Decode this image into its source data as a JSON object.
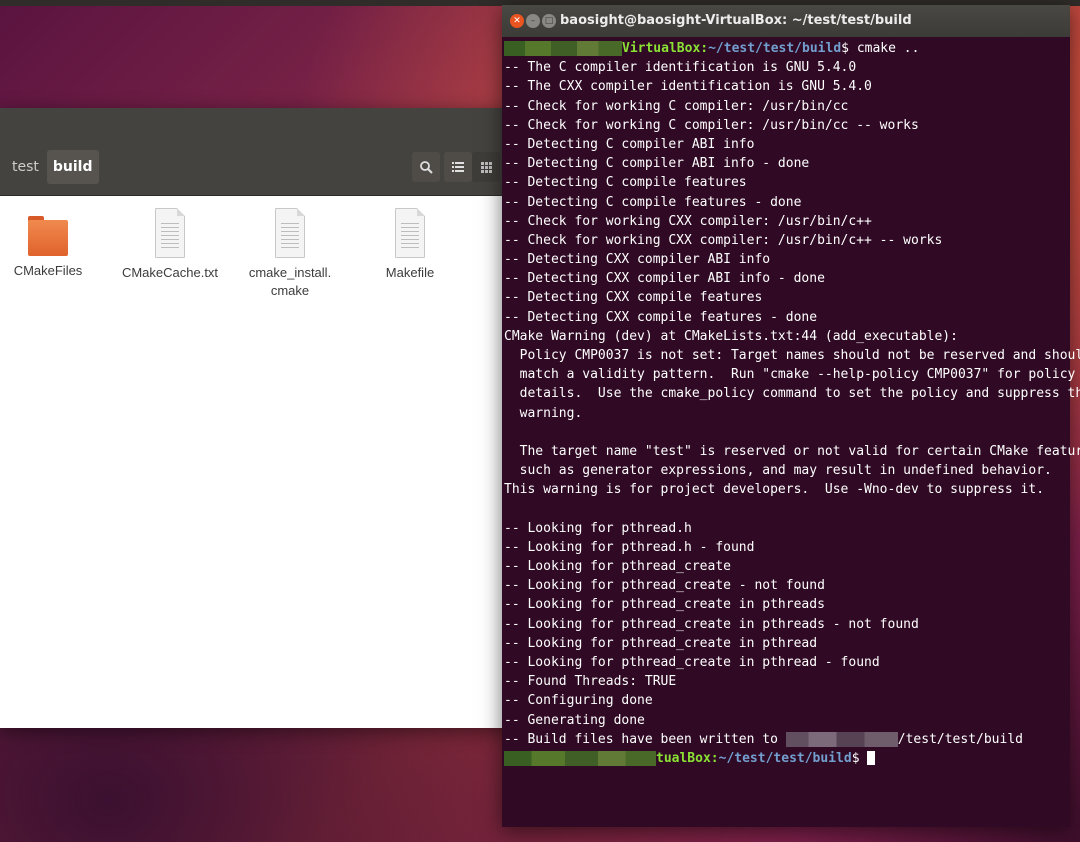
{
  "files": {
    "breadcrumbs": [
      "test",
      "build"
    ],
    "icons": {
      "search": "search-icon",
      "list": "list-view-icon",
      "grid": "grid-view-icon"
    },
    "items": [
      {
        "name": "CMakeFiles",
        "kind": "folder"
      },
      {
        "name": "CMakeCache.txt",
        "kind": "text-file"
      },
      {
        "name_line1": "cmake_install.",
        "name_line2": "cmake",
        "kind": "text-file"
      },
      {
        "name": "Makefile",
        "kind": "text-file"
      }
    ]
  },
  "terminal": {
    "title": "baosight@baosight-VirtualBox: ~/test/test/build",
    "colors": {
      "background": "#300a24",
      "prompt_user": "#8ae234",
      "prompt_path": "#729fcf"
    },
    "prompt1": {
      "user_visible": "VirtualBox:",
      "path": "~/test/test/build",
      "symbol": "$ ",
      "command": "cmake .."
    },
    "output": [
      "-- The C compiler identification is GNU 5.4.0",
      "-- The CXX compiler identification is GNU 5.4.0",
      "-- Check for working C compiler: /usr/bin/cc",
      "-- Check for working C compiler: /usr/bin/cc -- works",
      "-- Detecting C compiler ABI info",
      "-- Detecting C compiler ABI info - done",
      "-- Detecting C compile features",
      "-- Detecting C compile features - done",
      "-- Check for working CXX compiler: /usr/bin/c++",
      "-- Check for working CXX compiler: /usr/bin/c++ -- works",
      "-- Detecting CXX compiler ABI info",
      "-- Detecting CXX compiler ABI info - done",
      "-- Detecting CXX compile features",
      "-- Detecting CXX compile features - done",
      "CMake Warning (dev) at CMakeLists.txt:44 (add_executable):",
      "  Policy CMP0037 is not set: Target names should not be reserved and should",
      "  match a validity pattern.  Run \"cmake --help-policy CMP0037\" for policy",
      "  details.  Use the cmake_policy command to set the policy and suppress this",
      "  warning.",
      "",
      "  The target name \"test\" is reserved or not valid for certain CMake features,",
      "  such as generator expressions, and may result in undefined behavior.",
      "This warning is for project developers.  Use -Wno-dev to suppress it.",
      "",
      "-- Looking for pthread.h",
      "-- Looking for pthread.h - found",
      "-- Looking for pthread_create",
      "-- Looking for pthread_create - not found",
      "-- Looking for pthread_create in pthreads",
      "-- Looking for pthread_create in pthreads - not found",
      "-- Looking for pthread_create in pthread",
      "-- Looking for pthread_create in pthread - found",
      "-- Found Threads: TRUE",
      "-- Configuring done",
      "-- Generating done"
    ],
    "build_line": {
      "prefix": "-- Build files have been written to ",
      "suffix": "/test/test/build"
    },
    "prompt2": {
      "user_visible": "tualBox:",
      "path": "~/test/test/build",
      "symbol": "$ "
    }
  }
}
